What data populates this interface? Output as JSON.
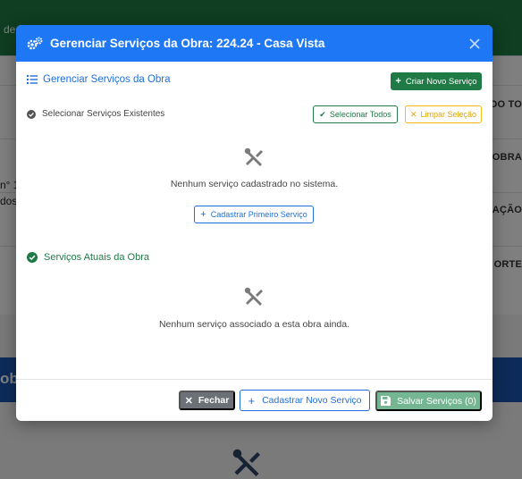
{
  "background": {
    "topbar_text": "de",
    "left_snippets": [
      "n° 1",
      "dos"
    ],
    "right_snippets": [
      "ADO TO",
      "OBRA",
      "AÇÃO",
      "ORTE"
    ],
    "band_text": "obr"
  },
  "modal": {
    "title": "Gerenciar Serviços da Obra: 224.24 - Casa Vista",
    "section_manage": "Gerenciar Serviços da Obra",
    "create_button": "Criar Novo Serviço",
    "select_existing": "Selecionar Serviços Existentes",
    "select_all_button": "Selecionar Todos",
    "clear_selection_button": "Limpar Seleção",
    "no_services_text": "Nenhum serviço cadastrado no sistema.",
    "first_service_button": "Cadastrar Primeiro Serviço",
    "current_services": "Serviços Atuais da Obra",
    "no_associated_text": "Nenhum serviço associado a esta obra ainda.",
    "footer": {
      "close_button": "Fechar",
      "new_service_button": "Cadastrar Novo Serviço",
      "save_button": "Salvar Serviços (0)"
    }
  },
  "colors": {
    "header": "#1e78f5",
    "primary": "#1e6fd9",
    "success": "#1f7a46",
    "warning": "#f5b912",
    "secondary": "#6c7178"
  }
}
